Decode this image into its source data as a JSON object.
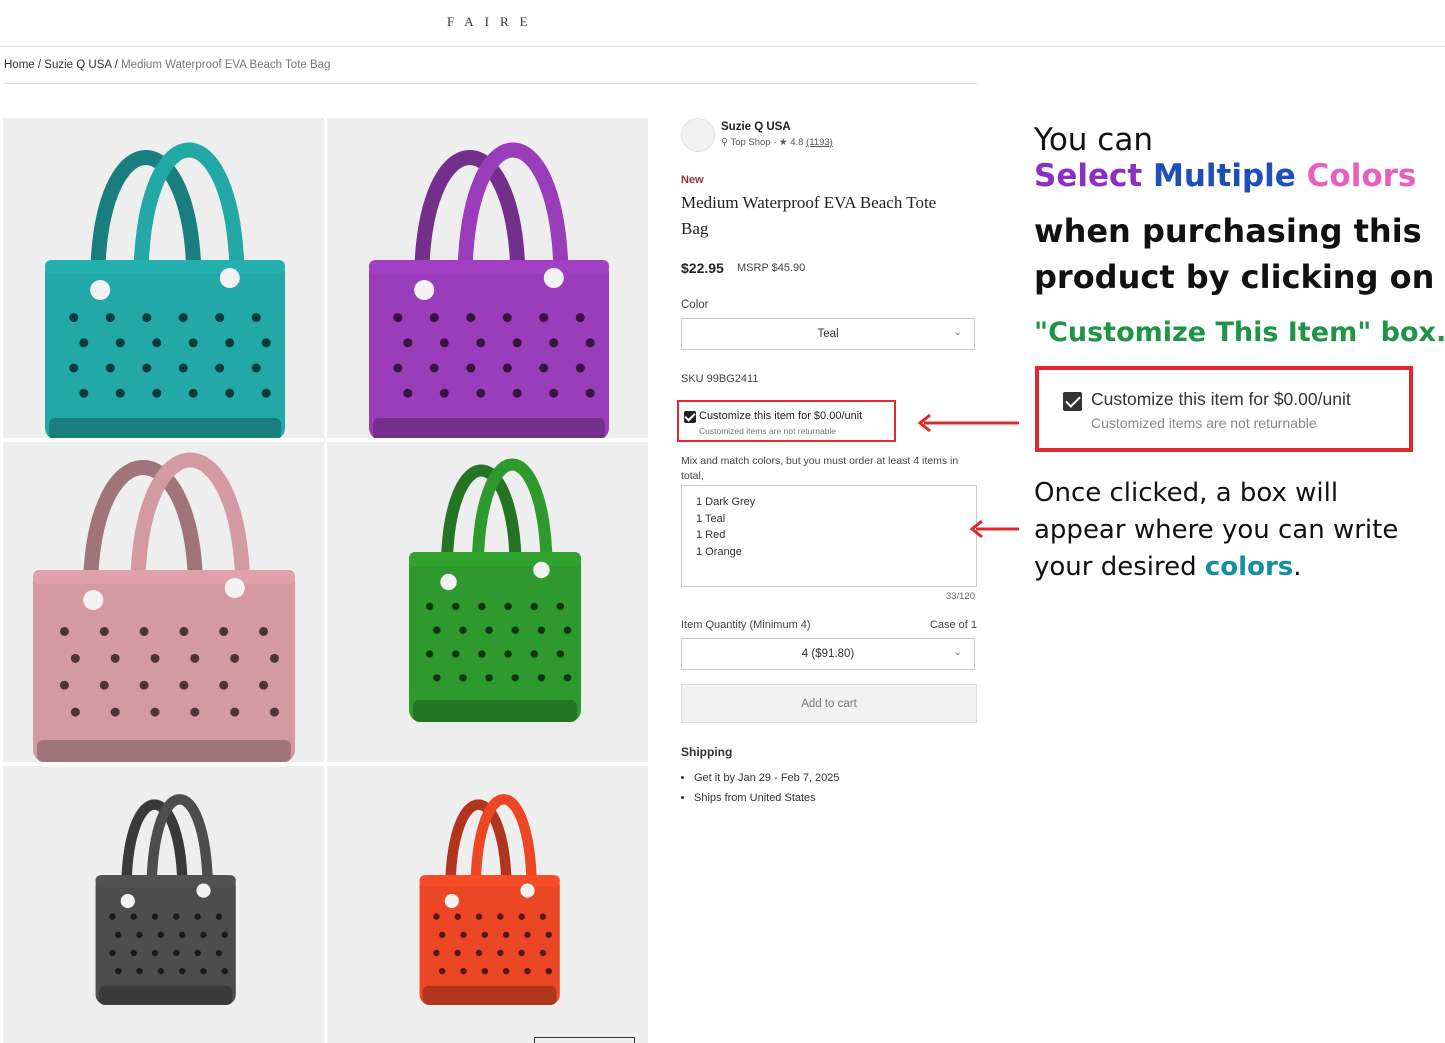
{
  "header": {
    "logo": "FAIRE"
  },
  "breadcrumb": {
    "home": "Home",
    "brand": "Suzie Q USA",
    "current": "Medium Waterproof EVA Beach Tote Bag"
  },
  "gallery": [
    {
      "color": "#23a8a8",
      "name": "teal"
    },
    {
      "color": "#9a3dbb",
      "name": "purple"
    },
    {
      "color": "#d49aa2",
      "name": "pink"
    },
    {
      "color": "#2e9a2e",
      "name": "green"
    },
    {
      "color": "#4d4d4d",
      "name": "dark-grey"
    },
    {
      "color": "#ec4725",
      "name": "orange"
    }
  ],
  "product": {
    "brand": "Suzie Q USA",
    "shop_badge": "Top Shop",
    "rating": "4.8",
    "reviews": "(1193)",
    "badge": "New",
    "title": "Medium Waterproof EVA Beach Tote Bag",
    "price": "$22.95",
    "msrp": "MSRP $45.90",
    "color_label": "Color",
    "color_value": "Teal",
    "sku": "SKU 99BG2411",
    "customize_label": "Customize this item for $0.00/unit",
    "customize_note": "Customized items are not returnable",
    "mix_note": "Mix and match colors, but you must order at least 4 items in total,",
    "custom_text": "1 Dark Grey\n1 Teal\n1 Red\n1 Orange",
    "char_count": "33/120",
    "quantity_label": "Item Quantity (Minimum 4)",
    "case_label": "Case of 1",
    "quantity_value": "4 ($91.80)",
    "add_to_cart": "Add to cart",
    "shipping_title": "Shipping",
    "shipping_items": [
      "Get it by Jan 29 - Feb 7, 2025",
      "Ships from United States"
    ]
  },
  "annotation": {
    "line1": "You can",
    "select": "Select",
    "multiple": "Multiple",
    "colors": "Colors",
    "line3a": "when purchasing this",
    "line3b": "product by clicking on",
    "line4": "\"Customize This Item\" box.",
    "zoom_label": "Customize this item for $0.00/unit",
    "zoom_note": "Customized items are not returnable",
    "line5a": "Once clicked, a box will",
    "line5b": "appear where you can write",
    "line5c_pre": "your desired",
    "line5c_colors": "colors",
    "line5c_post": ".",
    "accent_red": "#e0282e",
    "accent_green": "#1f9446"
  }
}
